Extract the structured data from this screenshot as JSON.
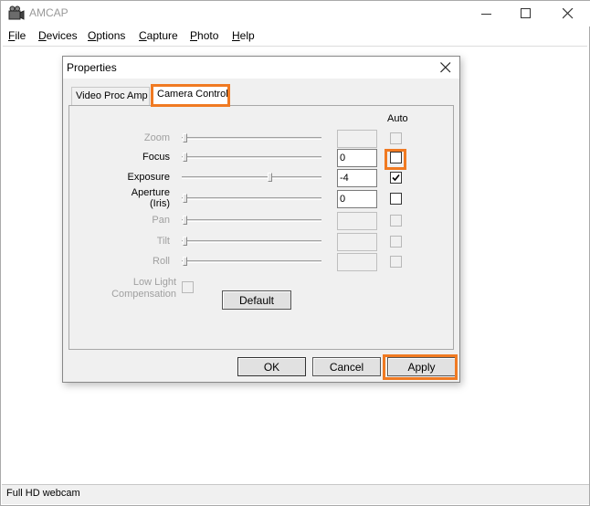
{
  "app": {
    "title": "AMCAP",
    "menu": [
      "File",
      "Devices",
      "Options",
      "Capture",
      "Photo",
      "Help"
    ],
    "status": "Full HD webcam"
  },
  "dialog": {
    "title": "Properties",
    "tabs": [
      "Video Proc Amp",
      "Camera Control"
    ],
    "active_tab": "Camera Control",
    "auto_header": "Auto",
    "controls": [
      {
        "label": "Zoom",
        "value": "",
        "enabled": false,
        "auto": false,
        "level": 0.0
      },
      {
        "label": "Focus",
        "value": "0",
        "enabled": true,
        "auto": false,
        "level": 0.0
      },
      {
        "label": "Exposure",
        "value": "-4",
        "enabled": true,
        "auto": true,
        "level": 0.64
      },
      {
        "label": "Aperture (Iris)",
        "value": "0",
        "enabled": true,
        "auto": false,
        "level": 0.0
      },
      {
        "label": "Pan",
        "value": "",
        "enabled": false,
        "auto": false,
        "level": 0.0
      },
      {
        "label": "Tilt",
        "value": "",
        "enabled": false,
        "auto": false,
        "level": 0.0
      },
      {
        "label": "Roll",
        "value": "",
        "enabled": false,
        "auto": false,
        "level": 0.0
      }
    ],
    "low_light": {
      "label_line1": "Low Light",
      "label_line2": "Compensation",
      "checked": false
    },
    "default_label": "Default",
    "ok_label": "OK",
    "cancel_label": "Cancel",
    "apply_label": "Apply"
  },
  "colors": {
    "highlight": "#f07a22"
  }
}
